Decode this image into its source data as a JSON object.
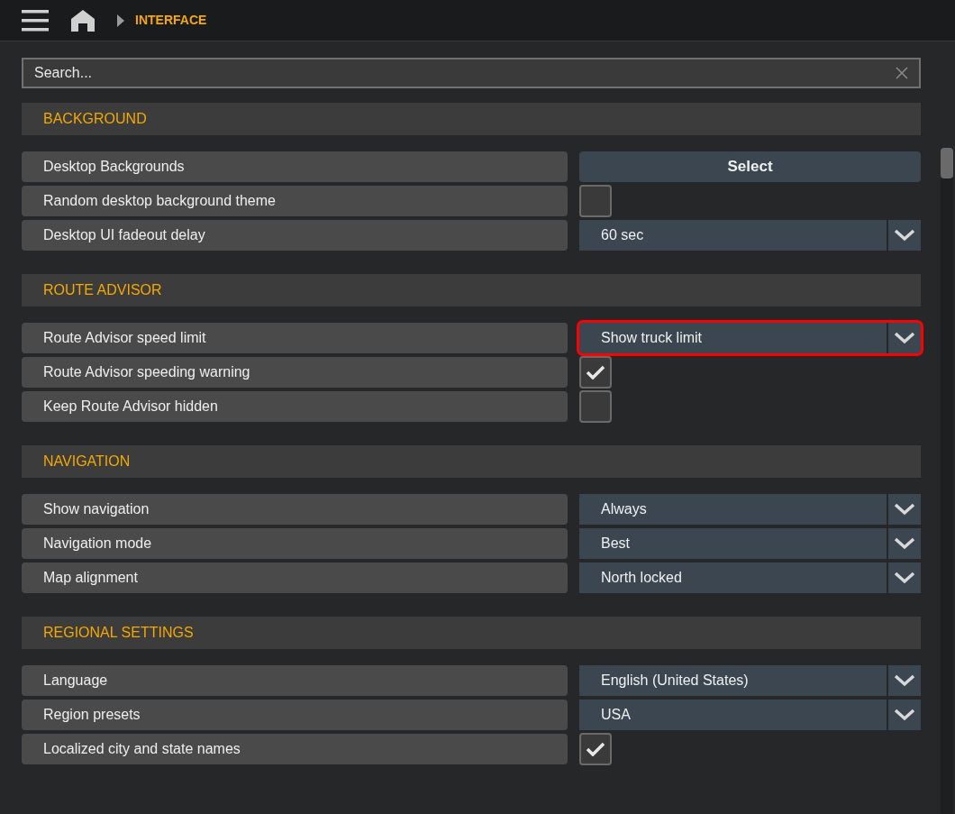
{
  "breadcrumb": {
    "current": "INTERFACE"
  },
  "search": {
    "placeholder": "Search..."
  },
  "sections": [
    {
      "title": "BACKGROUND",
      "rows": [
        {
          "kind": "button",
          "label": "Desktop Backgrounds",
          "button": "Select"
        },
        {
          "kind": "checkbox",
          "label": "Random desktop background theme",
          "checked": false
        },
        {
          "kind": "dropdown",
          "label": "Desktop UI fadeout delay",
          "value": "60 sec",
          "focused": false
        }
      ]
    },
    {
      "title": "ROUTE ADVISOR",
      "rows": [
        {
          "kind": "dropdown",
          "label": "Route Advisor speed limit",
          "value": "Show truck limit",
          "focused": true
        },
        {
          "kind": "checkbox",
          "label": "Route Advisor speeding warning",
          "checked": true
        },
        {
          "kind": "checkbox",
          "label": "Keep Route Advisor hidden",
          "checked": false
        }
      ]
    },
    {
      "title": "NAVIGATION",
      "rows": [
        {
          "kind": "dropdown",
          "label": "Show navigation",
          "value": "Always",
          "focused": false
        },
        {
          "kind": "dropdown",
          "label": "Navigation mode",
          "value": "Best",
          "focused": false
        },
        {
          "kind": "dropdown",
          "label": "Map alignment",
          "value": "North locked",
          "focused": false
        }
      ]
    },
    {
      "title": "REGIONAL SETTINGS",
      "rows": [
        {
          "kind": "dropdown",
          "label": "Language",
          "value": "English (United States)",
          "focused": false
        },
        {
          "kind": "dropdown",
          "label": "Region presets",
          "value": "USA",
          "focused": false
        },
        {
          "kind": "checkbox",
          "label": "Localized city and state names",
          "checked": true
        }
      ]
    }
  ]
}
